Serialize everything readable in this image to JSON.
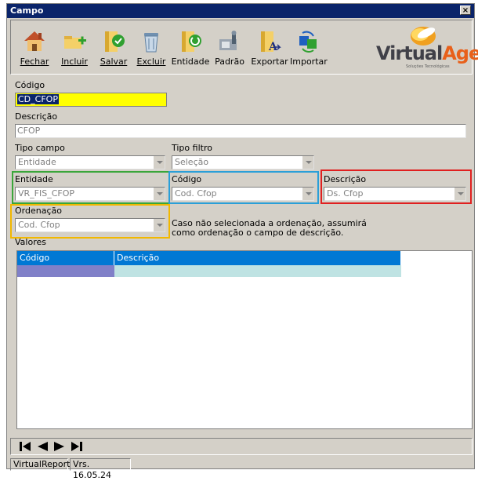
{
  "window": {
    "title": "Campo",
    "close_glyph": "×"
  },
  "toolbar": {
    "buttons": [
      {
        "label": "Fechar",
        "icon": "house-icon"
      },
      {
        "label": "Incluir",
        "icon": "add-folder-icon"
      },
      {
        "label": "Salvar",
        "icon": "save-folder-icon"
      },
      {
        "label": "Excluir",
        "icon": "trash-icon"
      },
      {
        "label": "Entidade",
        "icon": "entity-folder-icon"
      },
      {
        "label": "Padrão",
        "icon": "default-icon"
      },
      {
        "label": "Exportar",
        "icon": "export-icon"
      },
      {
        "label": "Importar",
        "icon": "import-icon"
      }
    ],
    "logo": {
      "text_a": "Virtual",
      "text_b": "Age",
      "tagline": "Soluções Tecnológicas"
    }
  },
  "form": {
    "codigo": {
      "label": "Código",
      "value": "CD_CFOP"
    },
    "descricao": {
      "label": "Descrição",
      "value": "CFOP"
    },
    "tipo_campo": {
      "label": "Tipo campo",
      "value": "Entidade"
    },
    "tipo_filtro": {
      "label": "Tipo filtro",
      "value": "Seleção"
    },
    "entidade": {
      "label": "Entidade",
      "value": "VR_FIS_CFOP"
    },
    "codigo_combo": {
      "label": "Código",
      "value": "Cod. Cfop"
    },
    "descricao_combo": {
      "label": "Descrição",
      "value": "Ds. Cfop"
    },
    "ordenacao": {
      "label": "Ordenação",
      "value": "Cod. Cfop"
    },
    "ordenacao_note_1": "Caso não selecionada a ordenação, assumirá",
    "ordenacao_note_2": "como ordenação o campo de descrição."
  },
  "valores": {
    "label": "Valores",
    "columns": [
      "Código",
      "Descrição"
    ]
  },
  "status": {
    "app": "VirtualReport",
    "version": "Vrs. 16.05.24"
  },
  "colors": {
    "titlebar": "#0a246a",
    "highlight_green": "#3aa63a",
    "highlight_blue": "#2a9fd8",
    "highlight_red": "#e02020",
    "highlight_yellow": "#f2b800",
    "grid_header": "#0078d4",
    "row_code": "#8080c8",
    "row_desc": "#bfe3e3",
    "codigo_bg": "#ffff00",
    "codigo_sel": "#0a246a"
  }
}
